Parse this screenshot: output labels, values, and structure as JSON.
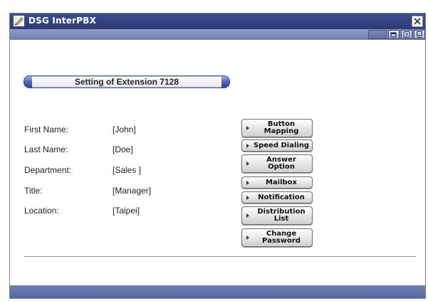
{
  "window": {
    "title": "DSG InterPBX"
  },
  "toolbar": {
    "icons": [
      "restore-icon",
      "help-icon",
      "exit-icon"
    ]
  },
  "header": {
    "title": "Setting of Extension 7128"
  },
  "fields": [
    {
      "label": "First Name:",
      "value": "[John]"
    },
    {
      "label": "Last Name:",
      "value": "[Doe]"
    },
    {
      "label": "Department:",
      "value": "[Sales ]"
    },
    {
      "label": "Title:",
      "value": "[Manager]"
    },
    {
      "label": "Location:",
      "value": "[Taipei]"
    }
  ],
  "buttons": [
    {
      "label": "Button\nMapping"
    },
    {
      "label": "Speed Dialing"
    },
    {
      "label": "Answer\nOption"
    },
    {
      "label": "Mailbox"
    },
    {
      "label": "Notification"
    },
    {
      "label": "Distribution\nList"
    },
    {
      "label": "Change\nPassword"
    }
  ],
  "colors": {
    "titlebar": "#2e3a72",
    "toolbar": "#7b89b5",
    "footer": "#5a6ca4"
  }
}
